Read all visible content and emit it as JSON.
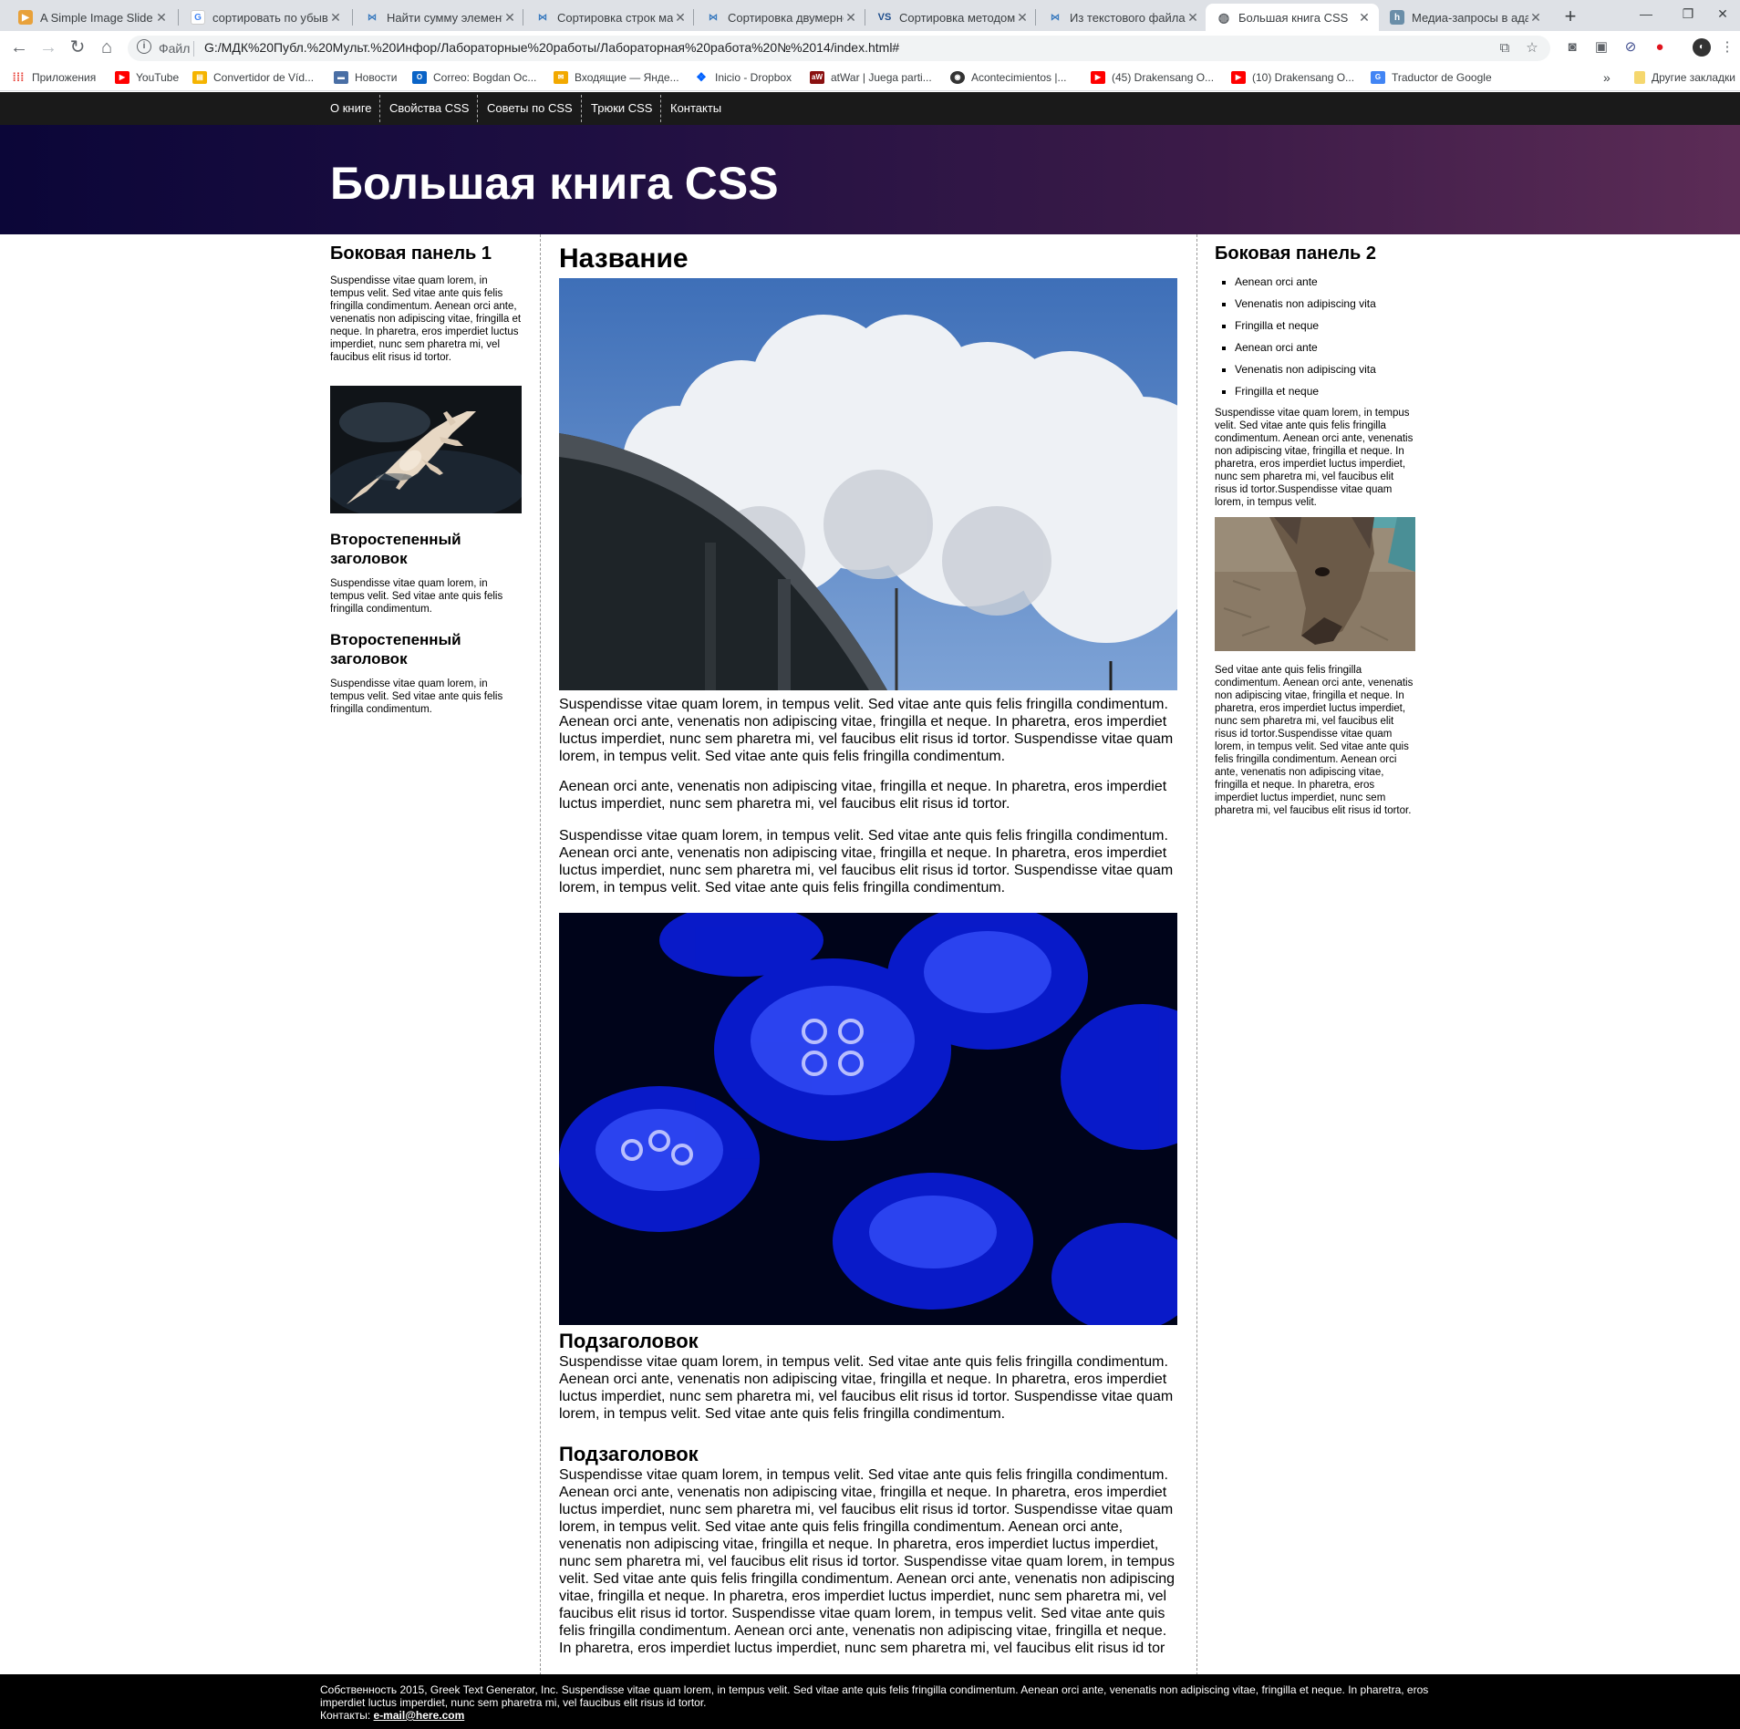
{
  "browser": {
    "tabs": [
      {
        "title": "A Simple Image Slide Sh",
        "icon": "slider-favicon-icon"
      },
      {
        "title": "сортировать по убыва",
        "icon": "google-favicon-icon"
      },
      {
        "title": "Найти сумму элемента",
        "icon": "cyberforum-favicon-icon"
      },
      {
        "title": "Сортировка строк мат",
        "icon": "cyberforum-favicon-icon"
      },
      {
        "title": "Сортировка двумерно",
        "icon": "cyberforum-favicon-icon"
      },
      {
        "title": "Сортировка методом",
        "icon": "vs-favicon-icon"
      },
      {
        "title": "Из текстового файла в",
        "icon": "cyberforum-favicon-icon"
      },
      {
        "title": "Большая книга CSS",
        "icon": "globe-icon",
        "active": true
      },
      {
        "title": "Медиа-запросы в ада",
        "icon": "habr-favicon-icon"
      }
    ],
    "address": {
      "scheme": "Файл",
      "url": "G:/МДК%20Публ.%20Мульт.%20Инфор/Лабораторные%20работы/Лабораторная%20работа%20№%2014/index.html#"
    },
    "bookmarks": [
      {
        "label": "Приложения",
        "icon": "apps-grid-icon"
      },
      {
        "label": "YouTube",
        "icon": "youtube-icon"
      },
      {
        "label": "Convertidor de Víd...",
        "icon": "video-converter-icon"
      },
      {
        "label": "Новости",
        "icon": "news-icon"
      },
      {
        "label": "Correo: Bogdan Oc...",
        "icon": "outlook-icon"
      },
      {
        "label": "Входящие — Янде...",
        "icon": "mail-icon"
      },
      {
        "label": "Inicio - Dropbox",
        "icon": "dropbox-icon"
      },
      {
        "label": "atWar | Juega parti...",
        "icon": "atwar-icon"
      },
      {
        "label": "Acontecimientos |...",
        "icon": "steam-icon"
      },
      {
        "label": "(45) Drakensang O...",
        "icon": "youtube-icon"
      },
      {
        "label": "(10) Drakensang O...",
        "icon": "youtube-icon"
      },
      {
        "label": "Traductor de Google",
        "icon": "google-translate-icon"
      }
    ],
    "bookmarks_overflow": "»",
    "other_bookmarks": "Другие закладки",
    "colors": {
      "tabstrip": "#dee1e6",
      "omnibox": "#f1f3f4"
    }
  },
  "site": {
    "nav": [
      "О книге",
      "Свойства CSS",
      "Советы по CSS",
      "Трюки CSS",
      "Контакты"
    ],
    "title": "Большая книга CSS",
    "sidebar1": {
      "heading": "Боковая панель 1",
      "text": "Suspendisse vitae quam lorem, in tempus velit. Sed vitae ante quis felis fringilla condimentum. Aenean orci ante, venenatis non adipiscing vitae, fringilla et neque. In pharetra, eros imperdiet luctus imperdiet, nunc sem pharetra mi, vel faucibus elit risus id tortor.",
      "image": "albino-alligator-photo",
      "sub1": "Второстепенный заголовок",
      "sub1_text": "Suspendisse vitae quam lorem, in tempus velit. Sed vitae ante quis felis fringilla condimentum.",
      "sub2": "Второстепенный заголовок",
      "sub2_text": "Suspendisse vitae quam lorem, in tempus velit. Sed vitae ante quis felis fringilla condimentum."
    },
    "main": {
      "heading": "Название",
      "image1": "clouds-and-overpass-photo",
      "p1": "Suspendisse vitae quam lorem, in tempus velit. Sed vitae ante quis felis fringilla condimentum. Aenean orci ante, venenatis non adipiscing vitae, fringilla et neque. In pharetra, eros imperdiet luctus imperdiet, nunc sem pharetra mi, vel faucibus elit risus id tortor. Suspendisse vitae quam lorem, in tempus velit. Sed vitae ante quis felis fringilla condimentum.",
      "p2": "Aenean orci ante, venenatis non adipiscing vitae, fringilla et neque. In pharetra, eros imperdiet luctus imperdiet, nunc sem pharetra mi, vel faucibus elit risus id tortor.",
      "p3": "Suspendisse vitae quam lorem, in tempus velit. Sed vitae ante quis felis fringilla condimentum. Aenean orci ante, venenatis non adipiscing vitae, fringilla et neque. In pharetra, eros imperdiet luctus imperdiet, nunc sem pharetra mi, vel faucibus elit risus id tortor. Suspendisse vitae quam lorem, in tempus velit. Sed vitae ante quis felis fringilla condimentum.",
      "image2": "blue-jellyfish-photo",
      "sub1": "Подзаголовок",
      "sub1_text": "Suspendisse vitae quam lorem, in tempus velit. Sed vitae ante quis felis fringilla condimentum. Aenean orci ante, venenatis non adipiscing vitae, fringilla et neque. In pharetra, eros imperdiet luctus imperdiet, nunc sem pharetra mi, vel faucibus elit risus id tortor. Suspendisse vitae quam lorem, in tempus velit. Sed vitae ante quis felis fringilla condimentum.",
      "sub2": "Подзаголовок",
      "sub2_text": "Suspendisse vitae quam lorem, in tempus velit. Sed vitae ante quis felis fringilla condimentum. Aenean orci ante, venenatis non adipiscing vitae, fringilla et neque. In pharetra, eros imperdiet luctus imperdiet, nunc sem pharetra mi, vel faucibus elit risus id tortor. Suspendisse vitae quam lorem, in tempus velit. Sed vitae ante quis felis fringilla condimentum. Aenean orci ante, venenatis non adipiscing vitae, fringilla et neque. In pharetra, eros imperdiet luctus imperdiet, nunc sem pharetra mi, vel faucibus elit risus id tortor. Suspendisse vitae quam lorem, in tempus velit. Sed vitae ante quis felis fringilla condimentum. Aenean orci ante, venenatis non adipiscing vitae, fringilla et neque. In pharetra, eros imperdiet luctus imperdiet, nunc sem pharetra mi, vel faucibus elit risus id tortor. Suspendisse vitae quam lorem, in tempus velit. Sed vitae ante quis felis fringilla condimentum. Aenean orci ante, venenatis non adipiscing vitae, fringilla et neque. In pharetra, eros imperdiet luctus imperdiet, nunc sem pharetra mi, vel faucibus elit risus id tor"
    },
    "sidebar2": {
      "heading": "Боковая панель 2",
      "list": [
        "Aenean orci ante",
        "Venenatis non adipiscing vita",
        "Fringilla et neque",
        "Aenean orci ante",
        "Venenatis non adipiscing vita",
        "Fringilla et neque"
      ],
      "text1": "Suspendisse vitae quam lorem, in tempus velit. Sed vitae ante quis felis fringilla condimentum. Aenean orci ante, venenatis non adipiscing vitae, fringilla et neque. In pharetra, eros imperdiet luctus imperdiet, nunc sem pharetra mi, vel faucibus elit risus id tortor.Suspendisse vitae quam lorem, in tempus velit.",
      "image": "donkey-photo",
      "text2": "Sed vitae ante quis felis fringilla condimentum. Aenean orci ante, venenatis non adipiscing vitae, fringilla et neque. In pharetra, eros imperdiet luctus imperdiet, nunc sem pharetra mi, vel faucibus elit risus id tortor.Suspendisse vitae quam lorem, in tempus velit. Sed vitae ante quis felis fringilla condimentum. Aenean orci ante, venenatis non adipiscing vitae, fringilla et neque. In pharetra, eros imperdiet luctus imperdiet, nunc sem pharetra mi, vel faucibus elit risus id tortor."
    },
    "footer": {
      "text": "Собственность 2015, Greek Text Generator, Inc. Suspendisse vitae quam lorem, in tempus velit. Sed vitae ante quis felis fringilla condimentum. Aenean orci ante, venenatis non adipiscing vitae, fringilla et neque. In pharetra, eros imperdiet luctus imperdiet, nunc sem pharetra mi, vel faucibus elit risus id tortor.",
      "contact_label": "Контакты:",
      "email": "e-mail@here.com"
    },
    "colors": {
      "nav_bg": "#1a1a1a",
      "banner_start": "#0b0638",
      "banner_end": "#5c2c56",
      "footer_bg": "#000000"
    }
  }
}
